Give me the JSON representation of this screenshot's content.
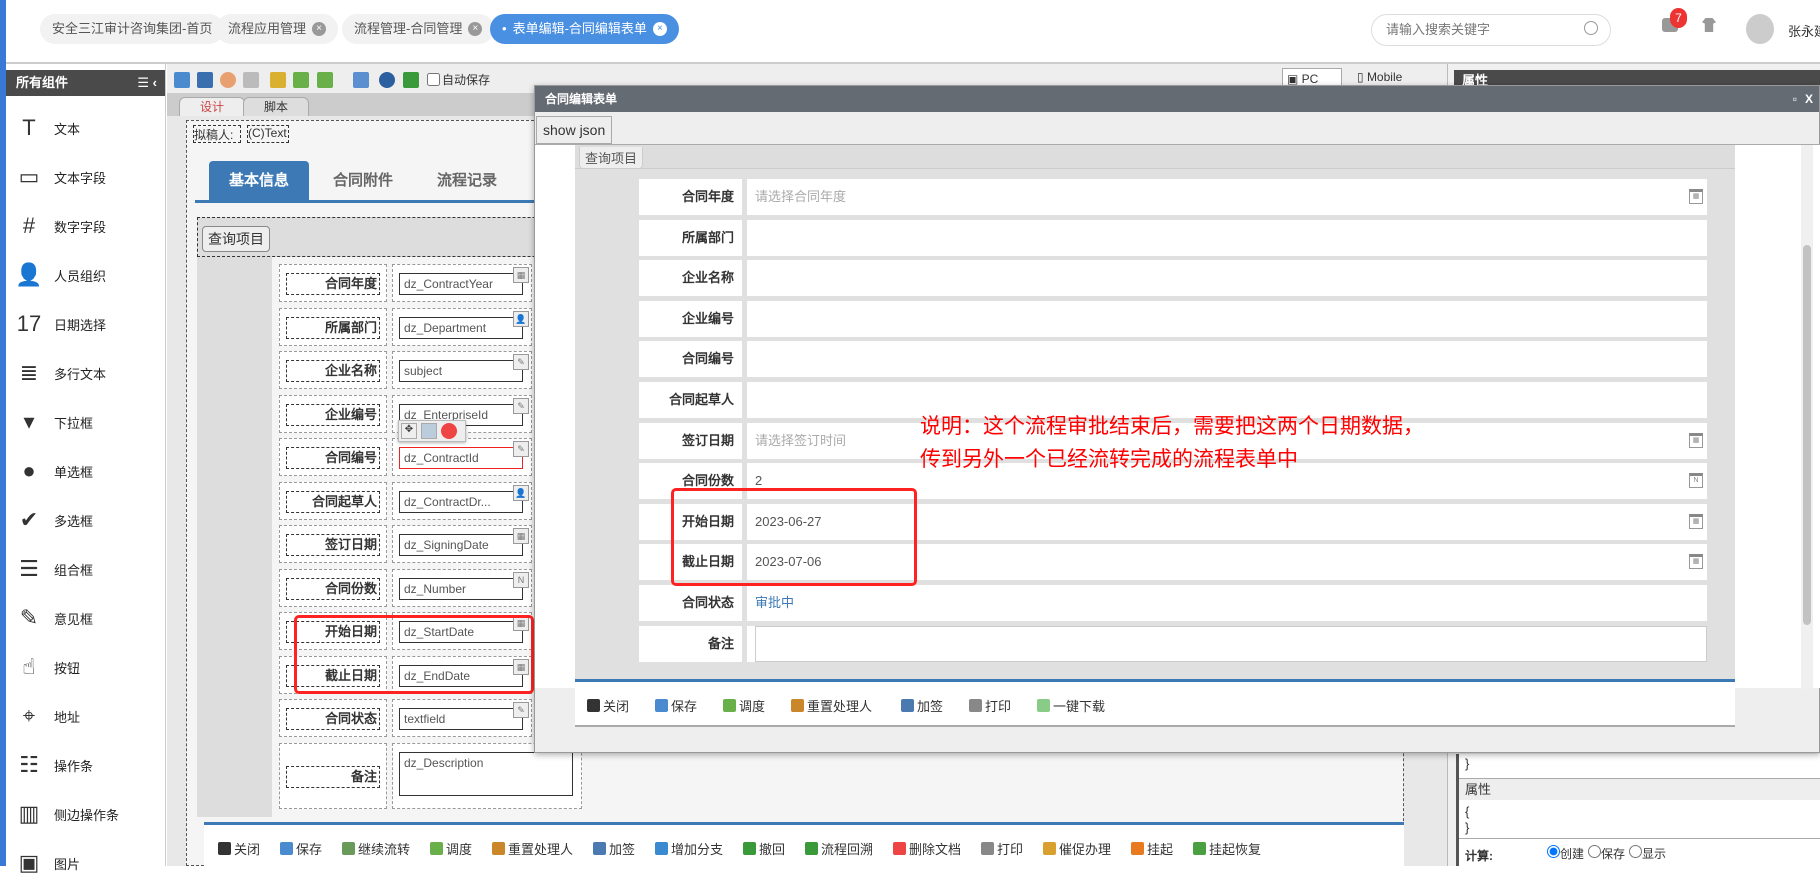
{
  "nav": {
    "tabs": [
      {
        "label": "安全三江审计咨询集团-首页"
      },
      {
        "label": "流程应用管理"
      },
      {
        "label": "流程管理-合同管理"
      },
      {
        "label": "表单编辑-合同编辑表单"
      }
    ],
    "search_placeholder": "请输入搜索关键字",
    "notification_count": "7",
    "username": "张永建"
  },
  "sidebar": {
    "title": "所有组件",
    "items": [
      {
        "label": "文本",
        "icon": "T"
      },
      {
        "label": "文本字段",
        "icon": "▭"
      },
      {
        "label": "数字字段",
        "icon": "#"
      },
      {
        "label": "人员组织",
        "icon": "👤"
      },
      {
        "label": "日期选择",
        "icon": "17"
      },
      {
        "label": "多行文本",
        "icon": "≣"
      },
      {
        "label": "下拉框",
        "icon": "▾"
      },
      {
        "label": "单选框",
        "icon": "●"
      },
      {
        "label": "多选框",
        "icon": "✔"
      },
      {
        "label": "组合框",
        "icon": "☰"
      },
      {
        "label": "意见框",
        "icon": "✎"
      },
      {
        "label": "按钮",
        "icon": "☝"
      },
      {
        "label": "地址",
        "icon": "⌖"
      },
      {
        "label": "操作条",
        "icon": "☷"
      },
      {
        "label": "侧边操作条",
        "icon": "▥"
      },
      {
        "label": "图片",
        "icon": "▣"
      }
    ]
  },
  "toolbar": {
    "autosave": "自动保存",
    "pc": "PC",
    "mobile": "Mobile"
  },
  "designer": {
    "tabs": [
      "设计",
      "脚本"
    ],
    "drafter_label": "拟稿人:",
    "drafter_value": "(C)Text",
    "form_tabs": [
      "基本信息",
      "合同附件",
      "流程记录"
    ],
    "query_tab": "查询项目",
    "fields": [
      {
        "label": "合同年度",
        "value": "dz_ContractYear",
        "icon": "cal"
      },
      {
        "label": "所属部门",
        "value": "dz_Department",
        "icon": "person"
      },
      {
        "label": "企业名称",
        "value": "subject",
        "icon": "edit"
      },
      {
        "label": "企业编号",
        "value": "dz_EnterpriseId",
        "icon": "edit"
      },
      {
        "label": "合同编号",
        "value": "dz_ContractId",
        "icon": "edit"
      },
      {
        "label": "合同起草人",
        "value": "dz_ContractDr...",
        "icon": "person"
      },
      {
        "label": "签订日期",
        "value": "dz_SigningDate",
        "icon": "cal"
      },
      {
        "label": "合同份数",
        "value": "dz_Number",
        "icon": "num"
      },
      {
        "label": "开始日期",
        "value": "dz_StartDate",
        "icon": "cal"
      },
      {
        "label": "截止日期",
        "value": "dz_EndDate",
        "icon": "cal"
      },
      {
        "label": "合同状态",
        "value": "textfield",
        "icon": "edit"
      },
      {
        "label": "备注",
        "value": "dz_Description",
        "icon": ""
      }
    ],
    "bottom_buttons": [
      "关闭",
      "保存",
      "继续流转",
      "调度",
      "重置处理人",
      "加签",
      "增加分支",
      "撤回",
      "流程回溯",
      "删除文档",
      "打印",
      "催促办理",
      "挂起",
      "挂起恢复"
    ]
  },
  "right_panel": {
    "title": "属性",
    "brace_close": "}",
    "props_title": "属性",
    "props_open": "{",
    "props_close": "}",
    "calc_label": "计算:",
    "calc_options": [
      "创建",
      "保存",
      "显示"
    ],
    "calc_selected": "创建"
  },
  "modal": {
    "title": "合同编辑表单",
    "show_json": "show json",
    "query_tab": "查询项目",
    "rows": [
      {
        "label": "合同年度",
        "value": "请选择合同年度",
        "placeholder": true,
        "cal": true
      },
      {
        "label": "所属部门",
        "value": ""
      },
      {
        "label": "企业名称",
        "value": ""
      },
      {
        "label": "企业编号",
        "value": ""
      },
      {
        "label": "合同编号",
        "value": ""
      },
      {
        "label": "合同起草人",
        "value": ""
      },
      {
        "label": "签订日期",
        "value": "请选择签订时间",
        "placeholder": true,
        "cal": true
      },
      {
        "label": "合同份数",
        "value": "2",
        "num": true
      },
      {
        "label": "开始日期",
        "value": "2023-06-27",
        "cal": true
      },
      {
        "label": "截止日期",
        "value": "2023-07-06",
        "cal": true
      },
      {
        "label": "合同状态",
        "value": "审批中",
        "status": true
      },
      {
        "label": "备注",
        "value": ""
      }
    ],
    "buttons": [
      "关闭",
      "保存",
      "调度",
      "重置处理人",
      "加签",
      "打印",
      "一键下载"
    ]
  },
  "annotation": {
    "line1": "说明：这个流程审批结束后，需要把这两个日期数据，",
    "line2": "传到另外一个已经流转完成的流程表单中"
  }
}
